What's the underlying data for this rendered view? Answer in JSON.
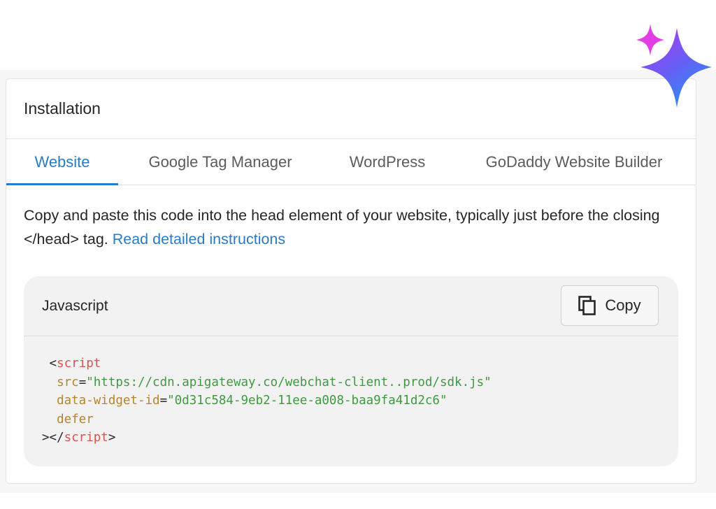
{
  "card": {
    "title": "Installation"
  },
  "tabs": [
    {
      "label": "Website",
      "active": true
    },
    {
      "label": "Google Tag Manager",
      "active": false
    },
    {
      "label": "WordPress",
      "active": false
    },
    {
      "label": "GoDaddy Website Builder",
      "active": false
    }
  ],
  "description": {
    "text_part1": "Copy and paste this code into the head element of your website, typically just before the closing </head> tag. ",
    "link_label": "Read detailed instructions"
  },
  "code_panel": {
    "language": "Javascript",
    "copy_label": "Copy",
    "copy_icon": "copy-icon",
    "code": {
      "open_bracket": "<",
      "tag_name": "script",
      "src_attr": "src",
      "src_value": "\"https://cdn.apigateway.co/webchat-client..prod/sdk.js\"",
      "widget_attr": "data-widget-id",
      "widget_value": "\"0d31c584-9eb2-11ee-a008-baa9fa41d2c6\"",
      "defer_attr": "defer",
      "close_open": "></",
      "close_tag_name": "script",
      "close_bracket": ">",
      "equals": "="
    }
  },
  "colors": {
    "accent": "#2a7bc5",
    "tag": "#d9534f",
    "attr": "#b5852d",
    "string": "#3f9a3f"
  },
  "decorations": {
    "sparkle_icon": "sparkle-icon"
  }
}
